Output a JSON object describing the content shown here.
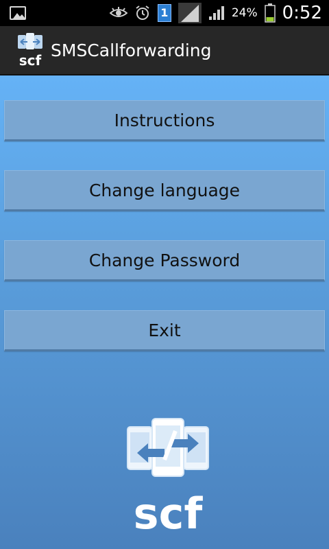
{
  "status_bar": {
    "icons": [
      "gallery-icon",
      "eye-icon",
      "alarm-icon",
      "sim-icon",
      "signal-icon",
      "signal-icon",
      "battery-icon"
    ],
    "sim_number": "1",
    "battery_percent": "24%",
    "time": "0:52"
  },
  "action_bar": {
    "app_name": "SMSCallforwarding",
    "logo_text": "scf"
  },
  "menu": {
    "instructions_label": "Instructions",
    "change_language_label": "Change language",
    "change_password_label": "Change Password",
    "exit_label": "Exit"
  },
  "footer_logo": {
    "text": "scf"
  },
  "colors": {
    "status_bar_bg": "#000000",
    "action_bar_bg": "#272727",
    "content_gradient_top": "#65b2f6",
    "content_gradient_bottom": "#4a81bd",
    "button_bg": "#7aa6d1"
  }
}
